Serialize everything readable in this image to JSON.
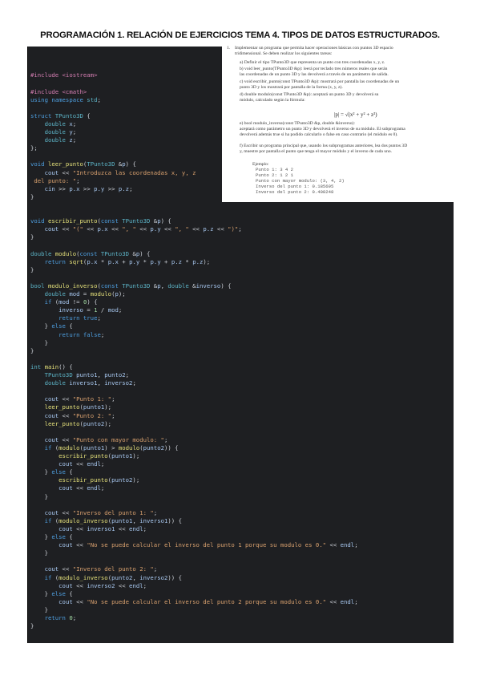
{
  "title": "PROGRAMACIÓN 1. RELACIÓN DE EJERCICIOS TEMA 4. TIPOS DE DATOS ESTRUCTURADOS.",
  "exercise": {
    "num": "1.",
    "intro_1": "Implementar un programa que permita hacer operaciones básicas con puntos 3D espacio",
    "intro_2": "tridimensional. Se deben realizar los siguientes tareas:",
    "a_1": "a)  Definir el tipo TPunto3D que representa un punto con tres coordenadas x, y, z.",
    "b_1": "b)  void leer_punto(TPunto3D &p): leerá por teclado tres números reales que serán",
    "b_2": "     las coordenadas de un punto 3D y las devolverá a través de un parámetro de salida.",
    "c_1": "c)  void escribir_punto(const TPunto3D &p): mostrará por pantalla las coordenadas de un",
    "c_2": "     punto 3D y los mostrará por pantalla de la forma (x, y, z).",
    "d_1": "d)  double modulo(const TPunto3D &p): aceptará un punto 3D y devolverá su",
    "d_2": "     módulo, calculado según la fórmula:",
    "formula": "|p| = √(x² + y² + z²)",
    "e_1": "e)  bool modulo_inverso(const TPunto3D &p, double &inverso):",
    "e_2": "     aceptará como parámetro un punto 3D y devolverá el inverso de su módulo. El subprograma",
    "e_3": "     devolverá además true si ha podido calcularlo o false en caso contrario (el módulo es 0).",
    "f_1": "f)  Escribir un programa principal que, usando los subprogramas anteriores, lea dos puntos 3D",
    "f_2": "     y, muestre por pantalla el punto que tenga el mayor módulo y el inverso de cada uno.",
    "example_label": "Ejemplo:",
    "ex_1": "Punto 1: 3 4 2",
    "ex_2": "Punto 2: 1 2 1",
    "ex_3": "Punto con mayor modulo: (3, 4, 2)",
    "ex_4": "Inverso del punto 1: 0.185695",
    "ex_5": "Inverso del punto 2: 0.408248"
  },
  "code_lines": [
    [],
    [],
    [],
    [
      [
        "pp",
        "#include <iostream>"
      ]
    ],
    [],
    [
      [
        "pp",
        "#include <cmath>"
      ]
    ],
    [
      [
        "kw",
        "using namespace "
      ],
      [
        "ty",
        "std"
      ],
      [
        "op",
        ";"
      ]
    ],
    [],
    [
      [
        "kw",
        "struct "
      ],
      [
        "ty",
        "TPunto3D"
      ],
      [
        "op",
        " {"
      ]
    ],
    [
      [
        "ty",
        "    double "
      ],
      [
        "va",
        "x"
      ],
      [
        "op",
        ";"
      ]
    ],
    [
      [
        "ty",
        "    double "
      ],
      [
        "va",
        "y"
      ],
      [
        "op",
        ";"
      ]
    ],
    [
      [
        "ty",
        "    double "
      ],
      [
        "va",
        "z"
      ],
      [
        "op",
        ";"
      ]
    ],
    [
      [
        "op",
        "};"
      ]
    ],
    [],
    [
      [
        "kw",
        "void "
      ],
      [
        "fn",
        "leer_punto"
      ],
      [
        "op",
        "("
      ],
      [
        "ty",
        "TPunto3D"
      ],
      [
        "op",
        " &"
      ],
      [
        "va",
        "p"
      ],
      [
        "op",
        ") {"
      ]
    ],
    [
      [
        "op",
        "    "
      ],
      [
        "va",
        "cout"
      ],
      [
        "op",
        " << "
      ],
      [
        "st",
        "\"Introduzca las coordenadas x, y, z"
      ]
    ],
    [
      [
        "st",
        " del punto: \""
      ],
      [
        "op",
        ";"
      ]
    ],
    [
      [
        "op",
        "    "
      ],
      [
        "va",
        "cin"
      ],
      [
        "op",
        " >> "
      ],
      [
        "va",
        "p.x"
      ],
      [
        "op",
        " >> "
      ],
      [
        "va",
        "p.y"
      ],
      [
        "op",
        " >> "
      ],
      [
        "va",
        "p.z"
      ],
      [
        "op",
        ";"
      ]
    ],
    [
      [
        "op",
        "}"
      ]
    ],
    [],
    [],
    [
      [
        "kw",
        "void "
      ],
      [
        "fn",
        "escribir_punto"
      ],
      [
        "op",
        "("
      ],
      [
        "kw",
        "const "
      ],
      [
        "ty",
        "TPunto3D"
      ],
      [
        "op",
        " &"
      ],
      [
        "va",
        "p"
      ],
      [
        "op",
        ") {"
      ]
    ],
    [
      [
        "op",
        "    "
      ],
      [
        "va",
        "cout"
      ],
      [
        "op",
        " << "
      ],
      [
        "st",
        "\"(\""
      ],
      [
        "op",
        " << "
      ],
      [
        "va",
        "p.x"
      ],
      [
        "op",
        " << "
      ],
      [
        "st",
        "\", \""
      ],
      [
        "op",
        " << "
      ],
      [
        "va",
        "p.y"
      ],
      [
        "op",
        " << "
      ],
      [
        "st",
        "\", \""
      ],
      [
        "op",
        " << "
      ],
      [
        "va",
        "p.z"
      ],
      [
        "op",
        " << "
      ],
      [
        "st",
        "\")\""
      ],
      [
        "op",
        ";"
      ]
    ],
    [
      [
        "op",
        "}"
      ]
    ],
    [],
    [
      [
        "ty",
        "double "
      ],
      [
        "fn",
        "modulo"
      ],
      [
        "op",
        "("
      ],
      [
        "kw",
        "const "
      ],
      [
        "ty",
        "TPunto3D"
      ],
      [
        "op",
        " &"
      ],
      [
        "va",
        "p"
      ],
      [
        "op",
        ") {"
      ]
    ],
    [
      [
        "kw",
        "    return "
      ],
      [
        "fn",
        "sqrt"
      ],
      [
        "op",
        "("
      ],
      [
        "va",
        "p.x"
      ],
      [
        "op",
        " * "
      ],
      [
        "va",
        "p.x"
      ],
      [
        "op",
        " + "
      ],
      [
        "va",
        "p.y"
      ],
      [
        "op",
        " * "
      ],
      [
        "va",
        "p.y"
      ],
      [
        "op",
        " + "
      ],
      [
        "va",
        "p.z"
      ],
      [
        "op",
        " * "
      ],
      [
        "va",
        "p.z"
      ],
      [
        "op",
        ");"
      ]
    ],
    [
      [
        "op",
        "}"
      ]
    ],
    [],
    [
      [
        "ty",
        "bool "
      ],
      [
        "fn",
        "modulo_inverso"
      ],
      [
        "op",
        "("
      ],
      [
        "kw",
        "const "
      ],
      [
        "ty",
        "TPunto3D"
      ],
      [
        "op",
        " &"
      ],
      [
        "va",
        "p"
      ],
      [
        "op",
        ", "
      ],
      [
        "ty",
        "double"
      ],
      [
        "op",
        " &"
      ],
      [
        "va",
        "inverso"
      ],
      [
        "op",
        ") {"
      ]
    ],
    [
      [
        "ty",
        "    double "
      ],
      [
        "va",
        "mod"
      ],
      [
        "op",
        " = "
      ],
      [
        "fn",
        "modulo"
      ],
      [
        "op",
        "("
      ],
      [
        "va",
        "p"
      ],
      [
        "op",
        ");"
      ]
    ],
    [
      [
        "kw",
        "    if "
      ],
      [
        "op",
        "("
      ],
      [
        "va",
        "mod"
      ],
      [
        "op",
        " != "
      ],
      [
        "nu",
        "0"
      ],
      [
        "op",
        ") {"
      ]
    ],
    [
      [
        "op",
        "        "
      ],
      [
        "va",
        "inverso"
      ],
      [
        "op",
        " = "
      ],
      [
        "nu",
        "1"
      ],
      [
        "op",
        " / "
      ],
      [
        "va",
        "mod"
      ],
      [
        "op",
        ";"
      ]
    ],
    [
      [
        "kw",
        "        return true"
      ],
      [
        "op",
        ";"
      ]
    ],
    [
      [
        "op",
        "    } "
      ],
      [
        "kw",
        "else"
      ],
      [
        "op",
        " {"
      ]
    ],
    [
      [
        "kw",
        "        return false"
      ],
      [
        "op",
        ";"
      ]
    ],
    [
      [
        "op",
        "    }"
      ]
    ],
    [
      [
        "op",
        "}"
      ]
    ],
    [],
    [
      [
        "ty",
        "int "
      ],
      [
        "fn",
        "main"
      ],
      [
        "op",
        "() {"
      ]
    ],
    [
      [
        "ty",
        "    TPunto3D "
      ],
      [
        "va",
        "punto1"
      ],
      [
        "op",
        ", "
      ],
      [
        "va",
        "punto2"
      ],
      [
        "op",
        ";"
      ]
    ],
    [
      [
        "ty",
        "    double "
      ],
      [
        "va",
        "inverso1"
      ],
      [
        "op",
        ", "
      ],
      [
        "va",
        "inverso2"
      ],
      [
        "op",
        ";"
      ]
    ],
    [],
    [
      [
        "op",
        "    "
      ],
      [
        "va",
        "cout"
      ],
      [
        "op",
        " << "
      ],
      [
        "st",
        "\"Punto 1: \""
      ],
      [
        "op",
        ";"
      ]
    ],
    [
      [
        "fn",
        "    leer_punto"
      ],
      [
        "op",
        "("
      ],
      [
        "va",
        "punto1"
      ],
      [
        "op",
        ");"
      ]
    ],
    [
      [
        "op",
        "    "
      ],
      [
        "va",
        "cout"
      ],
      [
        "op",
        " << "
      ],
      [
        "st",
        "\"Punto 2: \""
      ],
      [
        "op",
        ";"
      ]
    ],
    [
      [
        "fn",
        "    leer_punto"
      ],
      [
        "op",
        "("
      ],
      [
        "va",
        "punto2"
      ],
      [
        "op",
        ");"
      ]
    ],
    [],
    [
      [
        "op",
        "    "
      ],
      [
        "va",
        "cout"
      ],
      [
        "op",
        " << "
      ],
      [
        "st",
        "\"Punto con mayor modulo: \""
      ],
      [
        "op",
        ";"
      ]
    ],
    [
      [
        "kw",
        "    if "
      ],
      [
        "op",
        "("
      ],
      [
        "fn",
        "modulo"
      ],
      [
        "op",
        "("
      ],
      [
        "va",
        "punto1"
      ],
      [
        "op",
        ") > "
      ],
      [
        "fn",
        "modulo"
      ],
      [
        "op",
        "("
      ],
      [
        "va",
        "punto2"
      ],
      [
        "op",
        ")) {"
      ]
    ],
    [
      [
        "fn",
        "        escribir_punto"
      ],
      [
        "op",
        "("
      ],
      [
        "va",
        "punto1"
      ],
      [
        "op",
        ");"
      ]
    ],
    [
      [
        "op",
        "        "
      ],
      [
        "va",
        "cout"
      ],
      [
        "op",
        " << "
      ],
      [
        "va",
        "endl"
      ],
      [
        "op",
        ";"
      ]
    ],
    [
      [
        "op",
        "    } "
      ],
      [
        "kw",
        "else"
      ],
      [
        "op",
        " {"
      ]
    ],
    [
      [
        "fn",
        "        escribir_punto"
      ],
      [
        "op",
        "("
      ],
      [
        "va",
        "punto2"
      ],
      [
        "op",
        ");"
      ]
    ],
    [
      [
        "op",
        "        "
      ],
      [
        "va",
        "cout"
      ],
      [
        "op",
        " << "
      ],
      [
        "va",
        "endl"
      ],
      [
        "op",
        ";"
      ]
    ],
    [
      [
        "op",
        "    }"
      ]
    ],
    [],
    [
      [
        "op",
        "    "
      ],
      [
        "va",
        "cout"
      ],
      [
        "op",
        " << "
      ],
      [
        "st",
        "\"Inverso del punto 1: \""
      ],
      [
        "op",
        ";"
      ]
    ],
    [
      [
        "kw",
        "    if "
      ],
      [
        "op",
        "("
      ],
      [
        "fn",
        "modulo_inverso"
      ],
      [
        "op",
        "("
      ],
      [
        "va",
        "punto1"
      ],
      [
        "op",
        ", "
      ],
      [
        "va",
        "inverso1"
      ],
      [
        "op",
        ")) {"
      ]
    ],
    [
      [
        "op",
        "        "
      ],
      [
        "va",
        "cout"
      ],
      [
        "op",
        " << "
      ],
      [
        "va",
        "inverso1"
      ],
      [
        "op",
        " << "
      ],
      [
        "va",
        "endl"
      ],
      [
        "op",
        ";"
      ]
    ],
    [
      [
        "op",
        "    } "
      ],
      [
        "kw",
        "else"
      ],
      [
        "op",
        " {"
      ]
    ],
    [
      [
        "op",
        "        "
      ],
      [
        "va",
        "cout"
      ],
      [
        "op",
        " << "
      ],
      [
        "st",
        "\"No se puede calcular el inverso del punto 1 porque su modulo es 0.\""
      ],
      [
        "op",
        " << "
      ],
      [
        "va",
        "endl"
      ],
      [
        "op",
        ";"
      ]
    ],
    [
      [
        "op",
        "    }"
      ]
    ],
    [],
    [
      [
        "op",
        "    "
      ],
      [
        "va",
        "cout"
      ],
      [
        "op",
        " << "
      ],
      [
        "st",
        "\"Inverso del punto 2: \""
      ],
      [
        "op",
        ";"
      ]
    ],
    [
      [
        "kw",
        "    if "
      ],
      [
        "op",
        "("
      ],
      [
        "fn",
        "modulo_inverso"
      ],
      [
        "op",
        "("
      ],
      [
        "va",
        "punto2"
      ],
      [
        "op",
        ", "
      ],
      [
        "va",
        "inverso2"
      ],
      [
        "op",
        ")) {"
      ]
    ],
    [
      [
        "op",
        "        "
      ],
      [
        "va",
        "cout"
      ],
      [
        "op",
        " << "
      ],
      [
        "va",
        "inverso2"
      ],
      [
        "op",
        " << "
      ],
      [
        "va",
        "endl"
      ],
      [
        "op",
        ";"
      ]
    ],
    [
      [
        "op",
        "    } "
      ],
      [
        "kw",
        "else"
      ],
      [
        "op",
        " {"
      ]
    ],
    [
      [
        "op",
        "        "
      ],
      [
        "va",
        "cout"
      ],
      [
        "op",
        " << "
      ],
      [
        "st",
        "\"No se puede calcular el inverso del punto 2 porque su modulo es 0.\""
      ],
      [
        "op",
        " << "
      ],
      [
        "va",
        "endl"
      ],
      [
        "op",
        ";"
      ]
    ],
    [
      [
        "op",
        "    }"
      ]
    ],
    [
      [
        "kw",
        "    return "
      ],
      [
        "nu",
        "0"
      ],
      [
        "op",
        ";"
      ]
    ],
    [
      [
        "op",
        "}"
      ]
    ]
  ]
}
